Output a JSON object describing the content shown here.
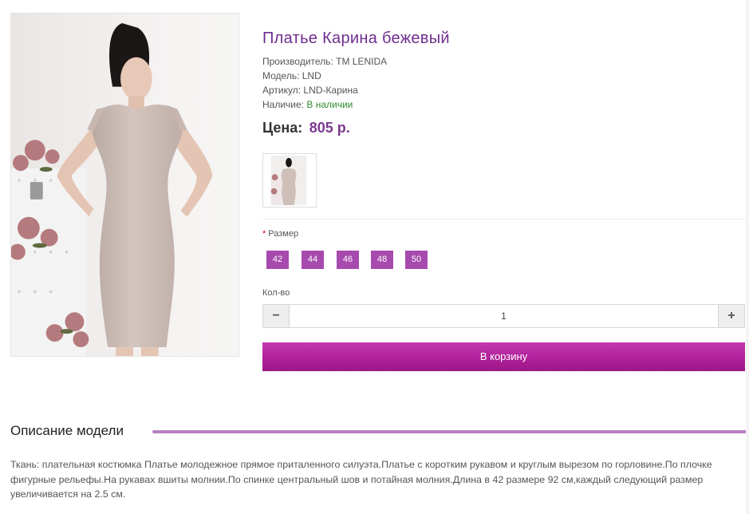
{
  "product": {
    "title": "Платье Карина бежевый",
    "manufacturer_label": "Производитель:",
    "manufacturer": "TM LENIDA",
    "model_label": "Модель:",
    "model": "LND",
    "sku_label": "Артикул:",
    "sku": "LND-Карина",
    "availability_label": "Наличие:",
    "availability": "В наличии",
    "price_label": "Цена:",
    "price": "805 р."
  },
  "options": {
    "size_required_mark": "*",
    "size_label": "Размер",
    "sizes": [
      "42",
      "44",
      "46",
      "48",
      "50"
    ]
  },
  "quantity": {
    "label": "Кол-во",
    "value": "1",
    "minus_icon": "minus-icon",
    "plus_icon": "plus-icon"
  },
  "cart": {
    "button_label": "В корзину"
  },
  "description": {
    "heading": "Описание модели",
    "text": "Ткань: плательная костюмка Платье молодежное прямое приталенного силуэта.Платье с коротким рукавом и круглым вырезом по горловине.По плочке фигурные рельефы.На рукавах вшиты молнии.По спинке центральный шов и потайная молния.Длина в 42 размере 92 см,каждый следующий размер увеличивается на 2.5 см."
  },
  "colors": {
    "title": "#6f2d8e",
    "price": "#7b3a8f",
    "size_button": "#a74aae",
    "cart_button": "#b0209a",
    "in_stock": "#2e8b2e",
    "description_rule": "#b681c0"
  }
}
